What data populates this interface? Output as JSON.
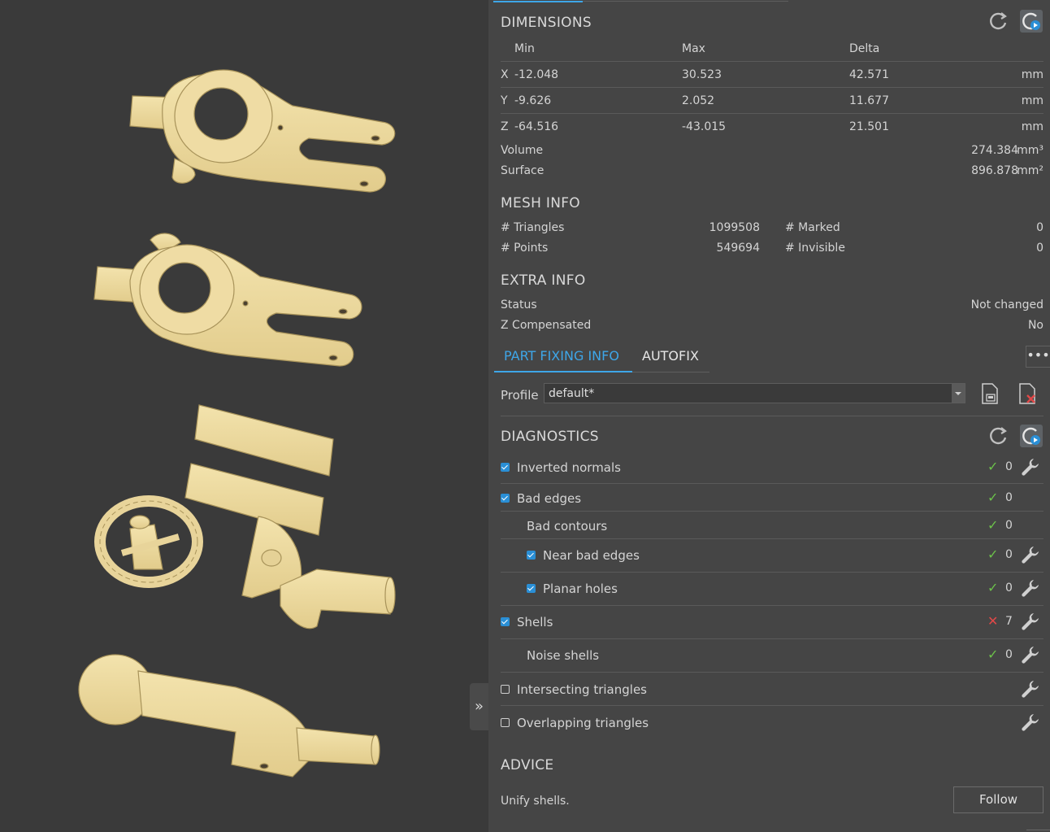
{
  "dimensions": {
    "title": "DIMENSIONS",
    "headers": [
      "Min",
      "Max",
      "Delta"
    ],
    "rows": [
      {
        "axis": "X",
        "min": "-12.048",
        "max": "30.523",
        "delta": "42.571",
        "unit": "mm"
      },
      {
        "axis": "Y",
        "min": "-9.626",
        "max": "2.052",
        "delta": "11.677",
        "unit": "mm"
      },
      {
        "axis": "Z",
        "min": "-64.516",
        "max": "-43.015",
        "delta": "21.501",
        "unit": "mm"
      }
    ],
    "volume_label": "Volume",
    "volume_value": "274.384",
    "volume_unit": "mm³",
    "surface_label": "Surface",
    "surface_value": "896.878",
    "surface_unit": "mm²"
  },
  "mesh_info": {
    "title": "MESH INFO",
    "triangles_label": "# Triangles",
    "triangles_value": "1099508",
    "points_label": "# Points",
    "points_value": "549694",
    "marked_label": "# Marked",
    "marked_value": "0",
    "invisible_label": "# Invisible",
    "invisible_value": "0"
  },
  "extra_info": {
    "title": "EXTRA INFO",
    "status_label": "Status",
    "status_value": "Not changed",
    "zcomp_label": "Z Compensated",
    "zcomp_value": "No"
  },
  "tabs": {
    "active": "PART FIXING INFO",
    "inactive": "AUTOFIX",
    "more": "•••"
  },
  "profile": {
    "label": "Profile",
    "value": "default*"
  },
  "diagnostics": {
    "title": "DIAGNOSTICS",
    "items": [
      {
        "label": "Inverted normals",
        "checkbox": "on",
        "status": "ok",
        "count": "0",
        "fix": true,
        "indent": 0
      },
      {
        "label": "Bad edges",
        "checkbox": "on",
        "status": "ok",
        "count": "0",
        "fix": false,
        "indent": 0
      },
      {
        "label": "Bad contours",
        "checkbox": "none",
        "status": "ok",
        "count": "0",
        "fix": false,
        "indent": 1
      },
      {
        "label": "Near bad edges",
        "checkbox": "on",
        "status": "ok",
        "count": "0",
        "fix": true,
        "indent": 1
      },
      {
        "label": "Planar holes",
        "checkbox": "on",
        "status": "ok",
        "count": "0",
        "fix": true,
        "indent": 1
      },
      {
        "label": "Shells",
        "checkbox": "on",
        "status": "error",
        "count": "7",
        "fix": true,
        "indent": 0
      },
      {
        "label": "Noise shells",
        "checkbox": "none",
        "status": "ok",
        "count": "0",
        "fix": true,
        "indent": 1
      },
      {
        "label": "Intersecting triangles",
        "checkbox": "off",
        "status": "none",
        "count": "",
        "fix": true,
        "indent": 0
      },
      {
        "label": "Overlapping triangles",
        "checkbox": "off",
        "status": "none",
        "count": "",
        "fix": true,
        "indent": 0
      }
    ]
  },
  "advice": {
    "title": "ADVICE",
    "text": "Unify shells.",
    "button": "Follow"
  },
  "viewport": {
    "collapse_glyph": "»"
  },
  "colors": {
    "accent": "#3ea6e8",
    "ok": "#6cc24a",
    "error": "#e04848",
    "part": "#ecd9a0"
  }
}
